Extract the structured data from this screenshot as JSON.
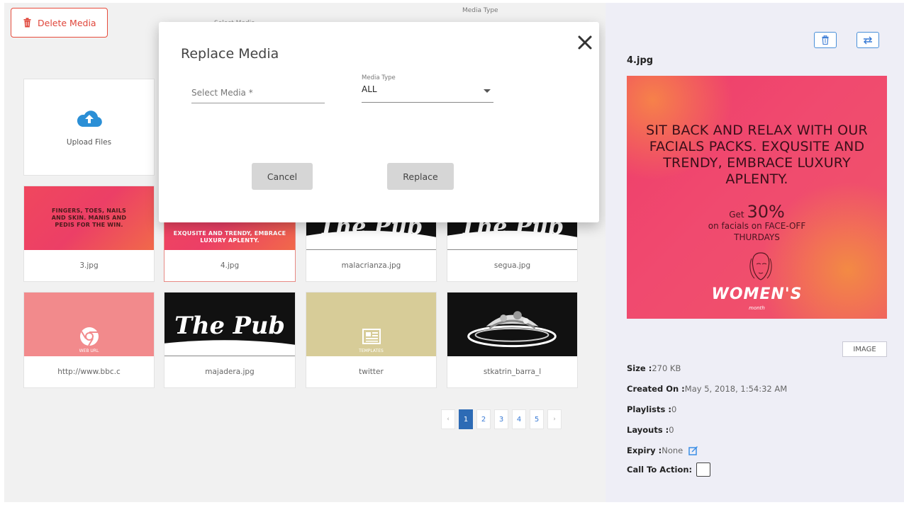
{
  "toolbar": {
    "delete_label": "Delete Media"
  },
  "background_filter": {
    "media_type_label": "Media Type",
    "select_label": "Select Media"
  },
  "upload": {
    "label": "Upload Files"
  },
  "thumb_texts": {
    "t3": "FINGERS, TOES, NAILS AND SKIN. MANIS AND PEDIS FOR THE WIN.",
    "t4": "EXQUSITE AND TRENDY, EMBRACE LUXURY APLENTY.",
    "pub": "The Pub",
    "web_url": "WEB URL",
    "templates": "TEMPLATES"
  },
  "media_items": [
    {
      "caption": "3.jpg"
    },
    {
      "caption": "4.jpg"
    },
    {
      "caption": "malacrianza.jpg"
    },
    {
      "caption": "segua.jpg"
    },
    {
      "caption": "http://www.bbc.c"
    },
    {
      "caption": "majadera.jpg"
    },
    {
      "caption": "twitter"
    },
    {
      "caption": "stkatrin_barra_l"
    }
  ],
  "pagination": {
    "prev": "‹",
    "pages": [
      "1",
      "2",
      "3",
      "4",
      "5"
    ],
    "next": "›",
    "active": "1"
  },
  "modal": {
    "title": "Replace Media",
    "select_media_placeholder": "Select Media *",
    "media_type_label": "Media Type",
    "media_type_value": "ALL",
    "cancel_label": "Cancel",
    "replace_label": "Replace"
  },
  "details": {
    "filename": "4.jpg",
    "preview_headline": "SIT BACK AND RELAX WITH OUR FACIALS PACKS. EXQUSITE AND TRENDY, EMBRACE LUXURY APLENTY.",
    "preview_offer_prefix": "Get",
    "preview_offer_value": "30%",
    "preview_offer_suffix": "on facials on FACE-OFF THURDAYS",
    "preview_brand": "WOMEN'S",
    "preview_brand_sub": "month",
    "type_badge": "IMAGE",
    "size_label": "Size :",
    "size_value": "270 KB",
    "created_label": "Created On :",
    "created_value": "May 5, 2018, 1:54:32 AM",
    "playlists_label": "Playlists :",
    "playlists_value": "0",
    "layouts_label": "Layouts :",
    "layouts_value": "0",
    "expiry_label": "Expiry :",
    "expiry_value": "None",
    "cta_label": "Call To Action:"
  },
  "colors": {
    "accent_red": "#e74c3c",
    "accent_blue": "#2d6bb5",
    "panel_bg": "#eeeef6"
  },
  "icons": [
    "trash-icon",
    "cloud-upload-icon",
    "close-icon",
    "swap-icon",
    "edit-icon",
    "chrome-icon",
    "news-icon",
    "caret-down-icon"
  ]
}
